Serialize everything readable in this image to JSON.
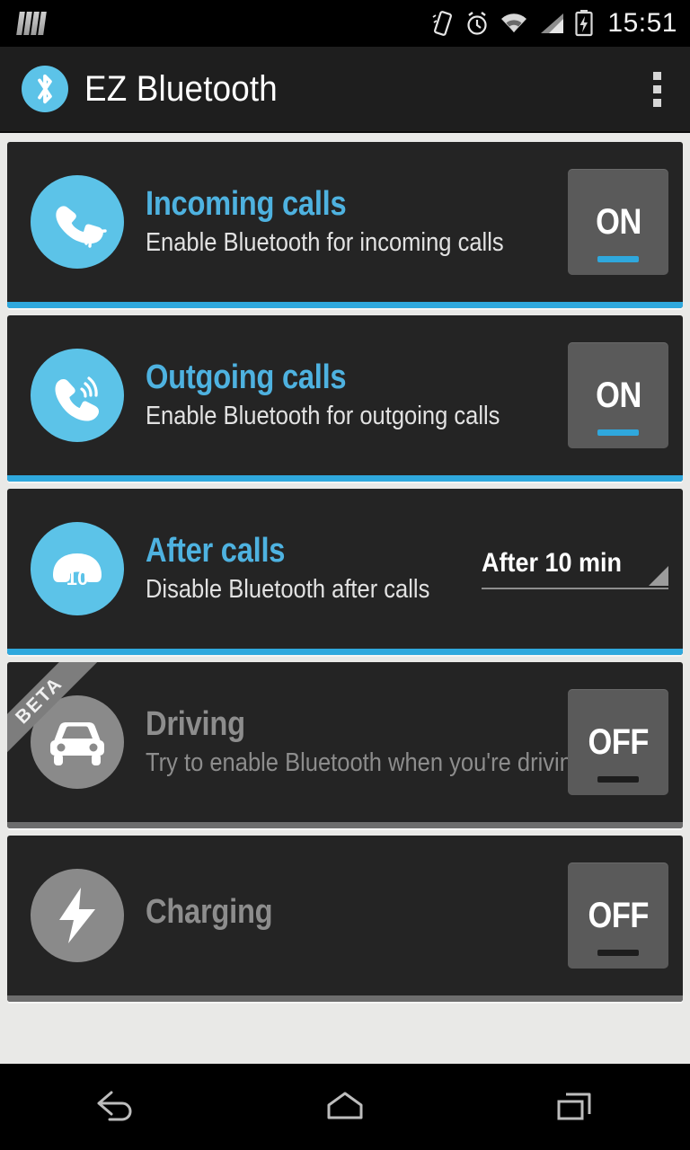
{
  "status_bar": {
    "time": "15:51",
    "left_icons": [
      "notification-bars-icon"
    ],
    "right_icons": [
      "vibrate-icon",
      "alarm-clock-icon",
      "wifi-icon",
      "cellular-signal-icon",
      "battery-charging-icon"
    ]
  },
  "action_bar": {
    "logo_icon": "bluetooth-icon",
    "title": "EZ Bluetooth",
    "overflow_icon": "overflow-menu-icon"
  },
  "colors": {
    "accent_blue": "#2fa8dd",
    "title_blue": "#4eb2e0",
    "avatar_blue": "#5cc3e8",
    "card_bg": "#242424",
    "page_bg": "#e9e9e7",
    "disabled_grey": "#8a8a8a"
  },
  "cards": [
    {
      "name": "incoming-calls",
      "icon": "phone-incoming-icon",
      "title": "Incoming calls",
      "subtitle": "Enable Bluetooth for incoming calls",
      "control": "toggle",
      "toggle_label": "ON",
      "state": "on",
      "enabled": true,
      "badge": null
    },
    {
      "name": "outgoing-calls",
      "icon": "phone-outgoing-icon",
      "title": "Outgoing calls",
      "subtitle": "Enable Bluetooth for outgoing calls",
      "control": "toggle",
      "toggle_label": "ON",
      "state": "on",
      "enabled": true,
      "badge": null
    },
    {
      "name": "after-calls",
      "icon": "phone-hangup-timer-icon",
      "icon_badge_text": "10",
      "title": "After calls",
      "subtitle": "Disable Bluetooth after calls",
      "control": "spinner",
      "spinner_value": "After 10 min",
      "enabled": true,
      "badge": null
    },
    {
      "name": "driving",
      "icon": "car-icon",
      "title": "Driving",
      "subtitle": "Try to enable Bluetooth when you're driving",
      "control": "toggle",
      "toggle_label": "OFF",
      "state": "off",
      "enabled": false,
      "badge": "BETA"
    },
    {
      "name": "charging",
      "icon": "lightning-bolt-icon",
      "title": "Charging",
      "subtitle": "",
      "control": "toggle",
      "toggle_label": "OFF",
      "state": "off",
      "enabled": false,
      "badge": null
    }
  ],
  "nav_bar": {
    "back_label": "back-icon",
    "home_label": "home-icon",
    "recents_label": "recents-icon"
  }
}
